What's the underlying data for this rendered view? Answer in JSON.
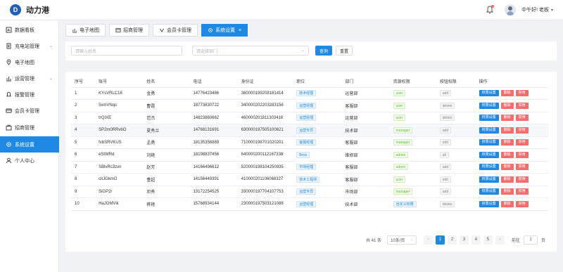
{
  "app": {
    "title": "动力港",
    "logo_letter": "D"
  },
  "header": {
    "greeting": "中午好! 老板"
  },
  "sidebar": {
    "items": [
      {
        "label": "数据看板",
        "icon": "dashboard-icon"
      },
      {
        "label": "充电站管理",
        "icon": "charging-icon",
        "has_arrow": true
      },
      {
        "label": "电子地图",
        "icon": "map-icon"
      },
      {
        "label": "运营管理",
        "icon": "operations-icon",
        "has_arrow": true
      },
      {
        "label": "报警管理",
        "icon": "alarm-icon"
      },
      {
        "label": "会员卡管理",
        "icon": "card-icon"
      },
      {
        "label": "招商管理",
        "icon": "business-icon"
      },
      {
        "label": "系统设置",
        "icon": "settings-icon",
        "active": true
      },
      {
        "label": "个人中心",
        "icon": "user-icon"
      }
    ]
  },
  "tabs": [
    {
      "label": "电子地图"
    },
    {
      "label": "招商管理"
    },
    {
      "label": "会员卡管理"
    },
    {
      "label": "系统设置",
      "active": true
    }
  ],
  "search": {
    "name_placeholder": "请输入姓名",
    "dept_placeholder": "请选择部门",
    "query_label": "查询",
    "reset_label": "重置"
  },
  "table": {
    "headers": [
      "序号",
      "账号",
      "姓名",
      "电话",
      "身份证",
      "职位",
      "部门",
      "资源权限",
      "按钮权限",
      "操作"
    ],
    "rows": [
      {
        "no": "1",
        "account": "KYsVRLC16",
        "name": "金勇",
        "phone": "14776423486",
        "id": "360000199208181414",
        "position": "技术经理",
        "dept": "运营部",
        "resource": "user",
        "button": "add"
      },
      {
        "no": "2",
        "account": "5xmVNqs",
        "name": "曹霞",
        "phone": "18773830722",
        "id": "340000202203283156",
        "position": "运营经理",
        "dept": "客服部",
        "resource": "user",
        "button": "delete"
      },
      {
        "no": "3",
        "account": "trQIXE",
        "name": "范杰",
        "phone": "14823860662",
        "id": "460000201811303416",
        "position": "运营经理",
        "dept": "运营部",
        "resource": "user",
        "button": "delete"
      },
      {
        "no": "4",
        "account": "SP2m0RRvbO",
        "name": "夏秀兰",
        "phone": "14768131691",
        "id": "630000197505100621",
        "position": "运营专员",
        "dept": "技术部",
        "resource": "manager",
        "button": "add"
      },
      {
        "no": "5",
        "account": "fvbSRVKUS",
        "name": "孟勇",
        "phone": "18135356889",
        "id": "710000198701020201",
        "position": "客服经理",
        "dept": "客服部",
        "resource": "manager",
        "button": "edit"
      },
      {
        "no": "6",
        "account": "eStWRd",
        "name": "刘艳",
        "phone": "18198837456",
        "id": "640000200112167338",
        "position": "Boss",
        "dept": "维修部",
        "resource": "admin",
        "button": "all"
      },
      {
        "no": "7",
        "account": "SBlvRc3zvn",
        "name": "赵芳",
        "phone": "14166496612",
        "id": "520000198104250935",
        "position": "市场经理",
        "dept": "客服部",
        "resource": "admin",
        "button": "add"
      },
      {
        "no": "8",
        "account": "citJGkmO",
        "name": "董超",
        "phone": "14156449391",
        "id": "410000201106068327",
        "position": "技术工程师",
        "dept": "客服部",
        "resource": "user",
        "button": "edit"
      },
      {
        "no": "9",
        "account": "SiGP2r",
        "name": "邓秀",
        "phone": "13172254525",
        "id": "330000197704107753",
        "position": "运营专员",
        "dept": "市场部",
        "resource": "manager",
        "button": "add"
      },
      {
        "no": "10",
        "account": "HaJGMVik",
        "name": "蒋艳",
        "phone": "15768934144",
        "id": "230000197503121088",
        "position": "运营经理",
        "dept": "技术部",
        "resource": "自定义权限",
        "button": "delete"
      }
    ],
    "actions": {
      "perm": "权限设置",
      "del": "删除",
      "disable": "禁用"
    }
  },
  "pagination": {
    "total": "共 41 条",
    "page_size": "10条/页",
    "pages": [
      "1",
      "2",
      "3",
      "4",
      "5"
    ],
    "current": "1",
    "goto_label": "前往",
    "goto_value": "1",
    "page_suffix": "页"
  },
  "colors": {
    "primary": "#1e88e5",
    "danger": "#f56c6c",
    "success": "#67c23a"
  }
}
